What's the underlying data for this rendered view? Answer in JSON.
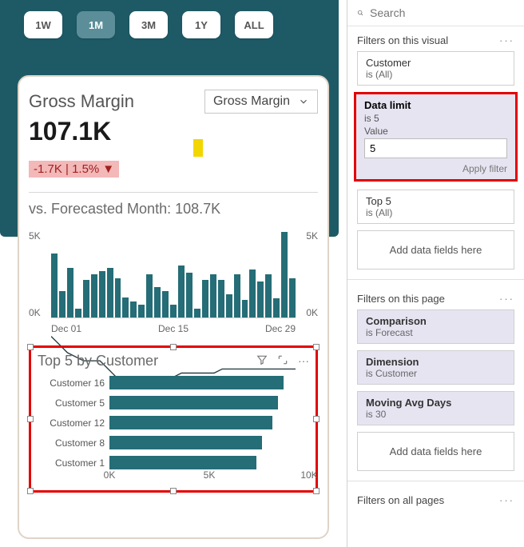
{
  "time_buttons": {
    "w1": "1W",
    "m1": "1M",
    "m3": "3M",
    "y1": "1Y",
    "all": "ALL",
    "active": "1M"
  },
  "card": {
    "title": "Gross Margin",
    "dropdown": "Gross Margin",
    "value": "107.1K",
    "delta": "-1.7K | 1.5%",
    "forecast": "vs. Forecasted Month: 108.7K"
  },
  "chart_data": {
    "type": "bar",
    "title": "",
    "xlabel": "",
    "ylabel": "",
    "ylim": [
      0,
      5
    ],
    "y_ticks": [
      "5K",
      "0K"
    ],
    "y_ticks_right": [
      "5K",
      "0K"
    ],
    "categories": [
      "Dec 01",
      "",
      "",
      "",
      "",
      "",
      "",
      "",
      "",
      "",
      "",
      "",
      "",
      "",
      "Dec 15",
      "",
      "",
      "",
      "",
      "",
      "",
      "",
      "",
      "",
      "",
      "",
      "",
      "",
      "Dec 29",
      "",
      ""
    ],
    "values": [
      4.4,
      1.8,
      3.4,
      0.6,
      2.6,
      3.0,
      3.2,
      3.4,
      2.7,
      1.4,
      1.1,
      0.9,
      3.0,
      2.1,
      1.8,
      0.9,
      3.6,
      3.1,
      0.6,
      2.6,
      3.0,
      2.6,
      1.6,
      3.0,
      1.2,
      3.3,
      2.5,
      3.0,
      1.3,
      5.9,
      2.7
    ],
    "trend": [
      3.4,
      3.2,
      3.0,
      2.9,
      2.8,
      2.8,
      2.8,
      2.6,
      2.4,
      2.3,
      2.3,
      2.3,
      2.4,
      2.4,
      2.4,
      2.4,
      2.5,
      2.5,
      2.5,
      2.5,
      2.5,
      2.6,
      2.6,
      2.6,
      2.6,
      2.6,
      2.6,
      2.6,
      2.6,
      2.6,
      2.6
    ]
  },
  "top5": {
    "title": "Top 5 by Customer",
    "x_ticks": [
      "0K",
      "5K",
      "10K"
    ],
    "rows": [
      {
        "label": "Customer 16",
        "value": 8700
      },
      {
        "label": "Customer 5",
        "value": 8450
      },
      {
        "label": "Customer 12",
        "value": 8150
      },
      {
        "label": "Customer 8",
        "value": 7650
      },
      {
        "label": "Customer 1",
        "value": 7350
      }
    ],
    "xmax": 10000
  },
  "filters": {
    "search_placeholder": "Search",
    "sec_visual": "Filters on this visual",
    "customer": {
      "name": "Customer",
      "state": "is (All)"
    },
    "data_limit": {
      "name": "Data limit",
      "state": "is 5",
      "value_label": "Value",
      "value": "5",
      "apply": "Apply filter"
    },
    "top5card": {
      "name": "Top 5",
      "state": "is (All)"
    },
    "add_fields": "Add data fields here",
    "sec_page": "Filters on this page",
    "comparison": {
      "name": "Comparison",
      "state": "is Forecast"
    },
    "dimension": {
      "name": "Dimension",
      "state": "is Customer"
    },
    "mavg": {
      "name": "Moving Avg Days",
      "state": "is 30"
    },
    "sec_all": "Filters on all pages"
  }
}
